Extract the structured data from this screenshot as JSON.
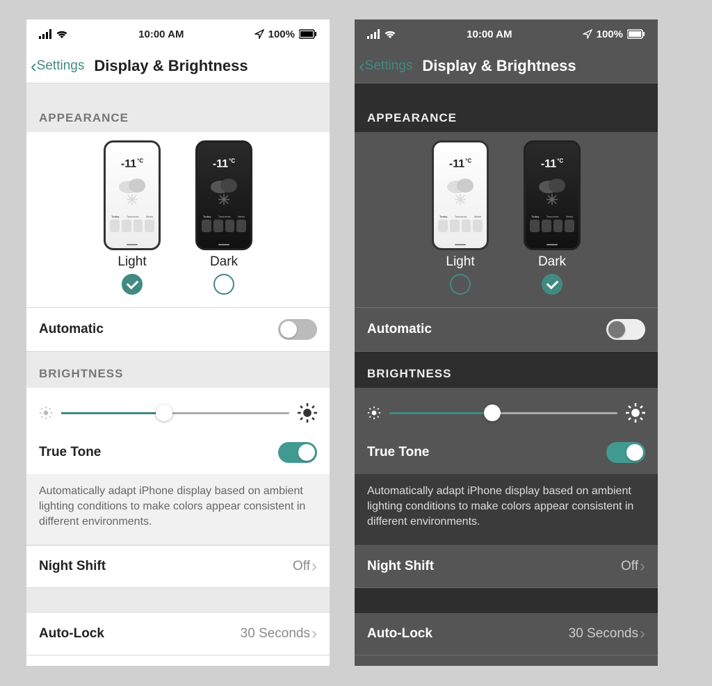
{
  "status": {
    "time": "10:00 AM",
    "battery": "100%"
  },
  "header": {
    "back": "Settings",
    "title": "Display & Brightness"
  },
  "sections": {
    "appearance": "APPEARANCE",
    "brightness": "BRIGHTNESS"
  },
  "appearance": {
    "temp_value": "-11",
    "temp_unit": "°C",
    "tabs": {
      "today": "Today",
      "tomorrow": "Tomorrow",
      "week": "Week"
    },
    "light_label": "Light",
    "dark_label": "Dark"
  },
  "rows": {
    "automatic": "Automatic",
    "truetone": "True Tone",
    "truetone_desc": "Automatically adapt iPhone display based on ambient lighting conditions to make colors appear  consistent in different environments.",
    "nightshift": "Night Shift",
    "nightshift_value": "Off",
    "autolock": "Auto-Lock",
    "autolock_value": "30 Seconds"
  },
  "brightness": {
    "value_pct": 45
  },
  "left": {
    "selected": "light",
    "automatic": false,
    "truetone": true
  },
  "right": {
    "selected": "dark",
    "automatic": false,
    "truetone": true
  }
}
